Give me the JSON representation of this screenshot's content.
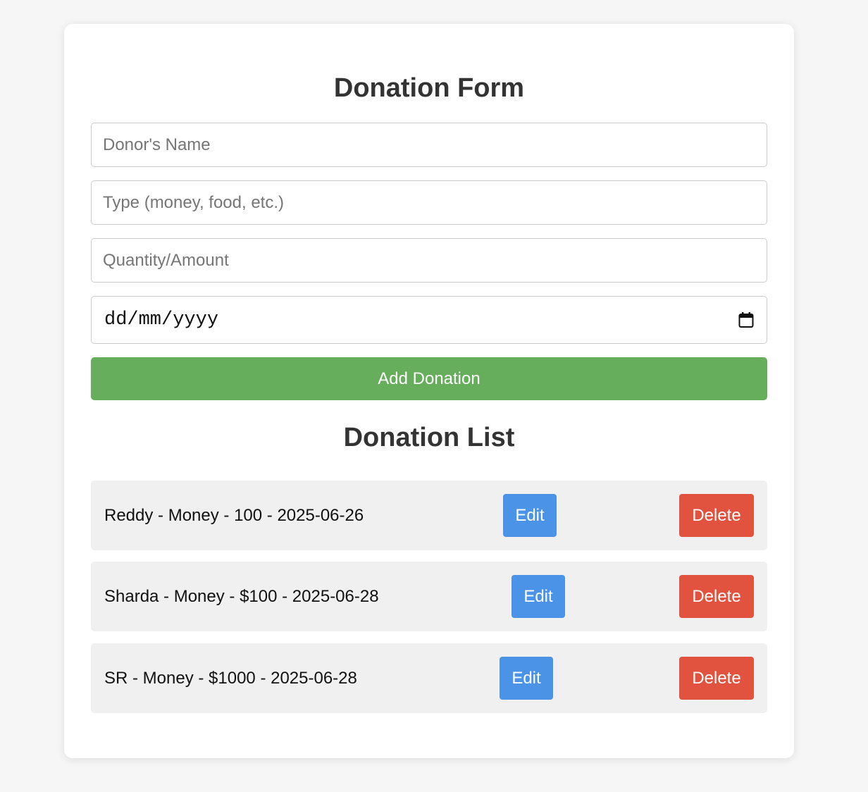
{
  "form": {
    "title": "Donation Form",
    "name_placeholder": "Donor's Name",
    "type_placeholder": "Type (money, food, etc.)",
    "quantity_placeholder": "Quantity/Amount",
    "date_placeholder": "dd/mm/yyyy",
    "submit_label": "Add Donation"
  },
  "list": {
    "title": "Donation List",
    "items": [
      {
        "text": "Reddy - Money - 100 - 2025-06-26",
        "edit_label": "Edit",
        "delete_label": "Delete"
      },
      {
        "text": "Sharda - Money - $100 - 2025-06-28",
        "edit_label": "Edit",
        "delete_label": "Delete"
      },
      {
        "text": "SR - Money - $1000 - 2025-06-28",
        "edit_label": "Edit",
        "delete_label": "Delete"
      }
    ]
  },
  "colors": {
    "add_button": "#66ae5c",
    "edit_button": "#4b93e6",
    "delete_button": "#e2533f",
    "row_background": "#f0f0f0",
    "page_background": "#f6f6f6"
  },
  "icons": {
    "date_picker": "calendar-icon"
  }
}
